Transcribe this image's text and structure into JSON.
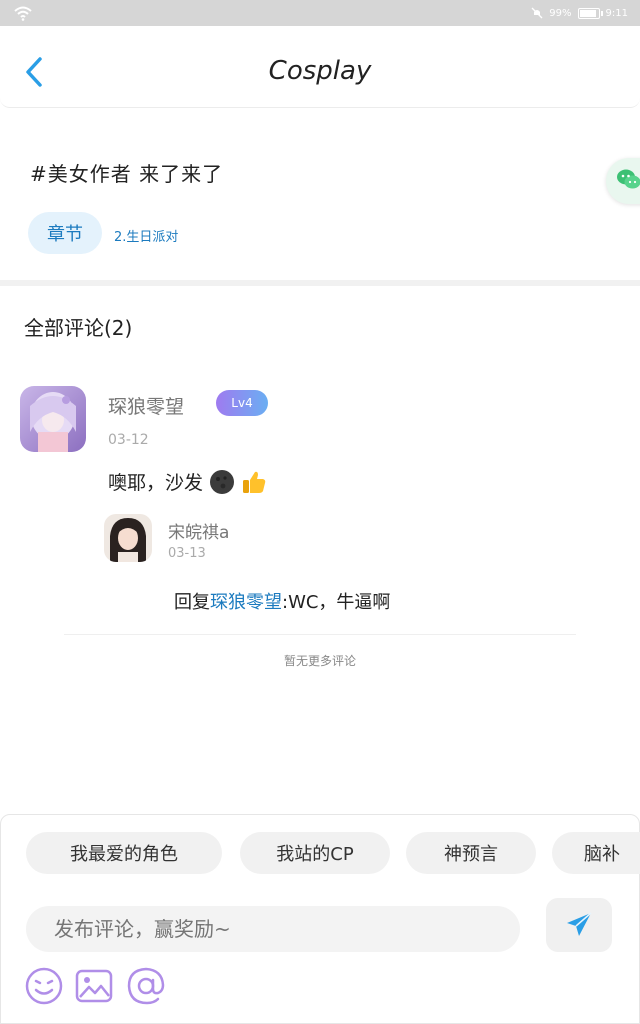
{
  "status_bar": {
    "battery": "99%",
    "time": "9:11"
  },
  "header": {
    "title": "Cosplay"
  },
  "post": {
    "tag_text": "#美女作者 来了来了",
    "chapter_chip": "章节",
    "chapter_name": "2.生日派对"
  },
  "comments": {
    "title": "全部评论(2)",
    "main": {
      "author": "琛狼零望",
      "level": "Lv4",
      "date": "03-12",
      "text": "噢耶，沙发"
    },
    "reply": {
      "author": "宋皖祺a",
      "date": "03-13",
      "prefix": "回复",
      "mention": "琛狼零望",
      "text": ":WC，牛逼啊"
    },
    "no_more": "暂无更多评论"
  },
  "quick_topics": [
    "我最爱的角色",
    "我站的CP",
    "神预言",
    "脑补"
  ],
  "input": {
    "placeholder": "发布评论，赢奖励~"
  },
  "icons": {
    "back": "chevron-left-icon",
    "send": "paper-plane-icon",
    "emoji": "smiley-icon",
    "image": "image-icon",
    "mention": "at-icon",
    "float": "wechat-icon"
  },
  "colors": {
    "accent": "#1c7bbf",
    "badge_start": "#9f7bf0",
    "badge_end": "#6aaef2",
    "purple_icon": "#b08ee8"
  }
}
